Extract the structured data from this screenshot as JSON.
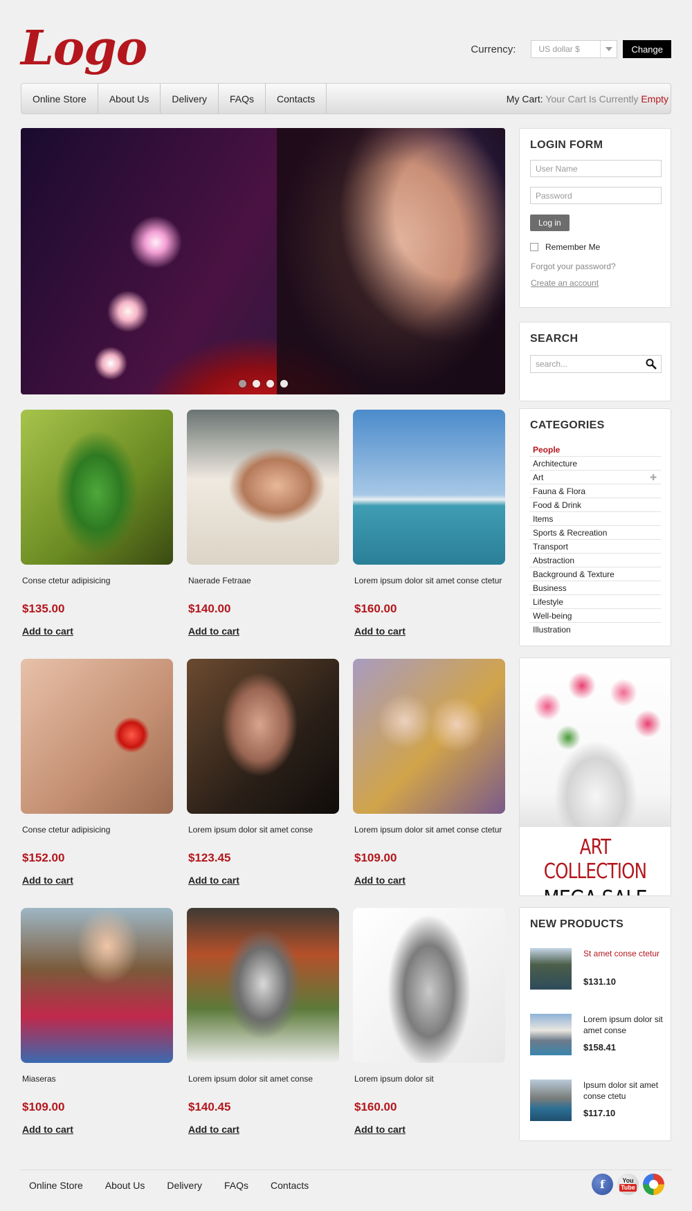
{
  "header": {
    "logo": "Logo",
    "currency_label": "Currency:",
    "currency_value": "US dollar $",
    "change_label": "Change"
  },
  "nav": {
    "items": [
      "Online Store",
      "About Us",
      "Delivery",
      "FAQs",
      "Contacts"
    ],
    "cart_label": "My Cart:",
    "cart_status": "Your Cart Is Currently",
    "cart_empty": "Empty"
  },
  "hero": {
    "slides": 4,
    "active_slide": 1
  },
  "products": [
    {
      "name": "Conse ctetur adipisicing",
      "price": "$135.00",
      "cta": "Add to cart",
      "image": "iguana"
    },
    {
      "name": "Naerade Fetraae",
      "price": "$140.00",
      "cta": "Add to cart",
      "image": "spa"
    },
    {
      "name": "Lorem ipsum dolor sit amet conse ctetur",
      "price": "$160.00",
      "cta": "Add to cart",
      "image": "sea"
    },
    {
      "name": "Conse ctetur adipisicing",
      "price": "$152.00",
      "cta": "Add to cart",
      "image": "heart"
    },
    {
      "name": "Lorem ipsum dolor sit amet conse",
      "price": "$123.45",
      "cta": "Add to cart",
      "image": "curly"
    },
    {
      "name": "Lorem ipsum dolor sit amet conse ctetur",
      "price": "$109.00",
      "cta": "Add to cart",
      "image": "fairies"
    },
    {
      "name": "Miaseras",
      "price": "$109.00",
      "cta": "Add to cart",
      "image": "smile"
    },
    {
      "name": "Lorem ipsum dolor sit amet conse",
      "price": "$140.45",
      "cta": "Add to cart",
      "image": "dog"
    },
    {
      "name": "Lorem ipsum dolor sit",
      "price": "$160.00",
      "cta": "Add to cart",
      "image": "silver"
    }
  ],
  "login": {
    "title": "LOGIN FORM",
    "username_placeholder": "User Name",
    "password_placeholder": "Password",
    "login_label": "Log in",
    "remember_label": "Remember Me",
    "forgot_label": "Forgot your password?",
    "create_label": "Create an account"
  },
  "search": {
    "title": "SEARCH",
    "placeholder": "search..."
  },
  "categories": {
    "title": "CATEGORIES",
    "items": [
      "People",
      "Architecture",
      "Art",
      "Fauna & Flora",
      "Food & Drink",
      "Items",
      "Sports & Recreation",
      "Transport",
      "Abstraction",
      "Background & Texture",
      "Business",
      "Lifestyle",
      "Well-being",
      "Illustration"
    ],
    "active": "People",
    "expandable": "Art"
  },
  "banner": {
    "line1": "ART COLLECTION",
    "line2": "MEGA SALE"
  },
  "new_products": {
    "title": "NEW PRODUCTS",
    "items": [
      {
        "name": "St amet conse ctetur",
        "price": "$131.10"
      },
      {
        "name": "Lorem ipsum dolor sit amet conse",
        "price": "$158.41"
      },
      {
        "name": "Ipsum dolor sit amet conse ctetu",
        "price": "$117.10"
      }
    ]
  },
  "footer": {
    "items": [
      "Online Store",
      "About Us",
      "Delivery",
      "FAQs",
      "Contacts"
    ],
    "social": [
      "facebook-icon",
      "youtube-icon",
      "google-icon"
    ]
  },
  "colors": {
    "accent": "#b3161c",
    "background": "#f0f0f0"
  }
}
